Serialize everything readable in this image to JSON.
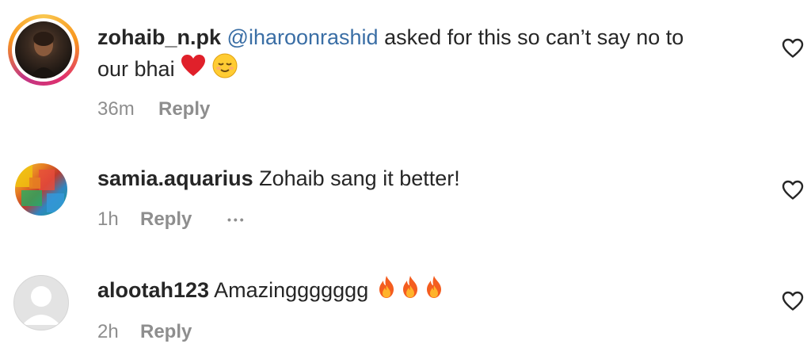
{
  "comments": [
    {
      "username": "zohaib_n.pk",
      "mention": "@iharoonrashid",
      "text_line1": " asked for this so can’t say no to",
      "text_line2": "our bhai",
      "emojis": [
        "red-heart",
        "relieved-face"
      ],
      "time": "36m",
      "reply_label": "Reply",
      "like_icon": "heart-outline-icon"
    },
    {
      "username": "samia.aquarius",
      "text": " Zohaib sang it better!",
      "time": "1h",
      "reply_label": "Reply",
      "more_label": "•••",
      "like_icon": "heart-outline-icon"
    },
    {
      "username": "alootah123",
      "text": " Amazinggggggg",
      "emojis": [
        "fire",
        "fire",
        "fire"
      ],
      "time": "2h",
      "reply_label": "Reply",
      "like_icon": "heart-outline-icon"
    }
  ]
}
